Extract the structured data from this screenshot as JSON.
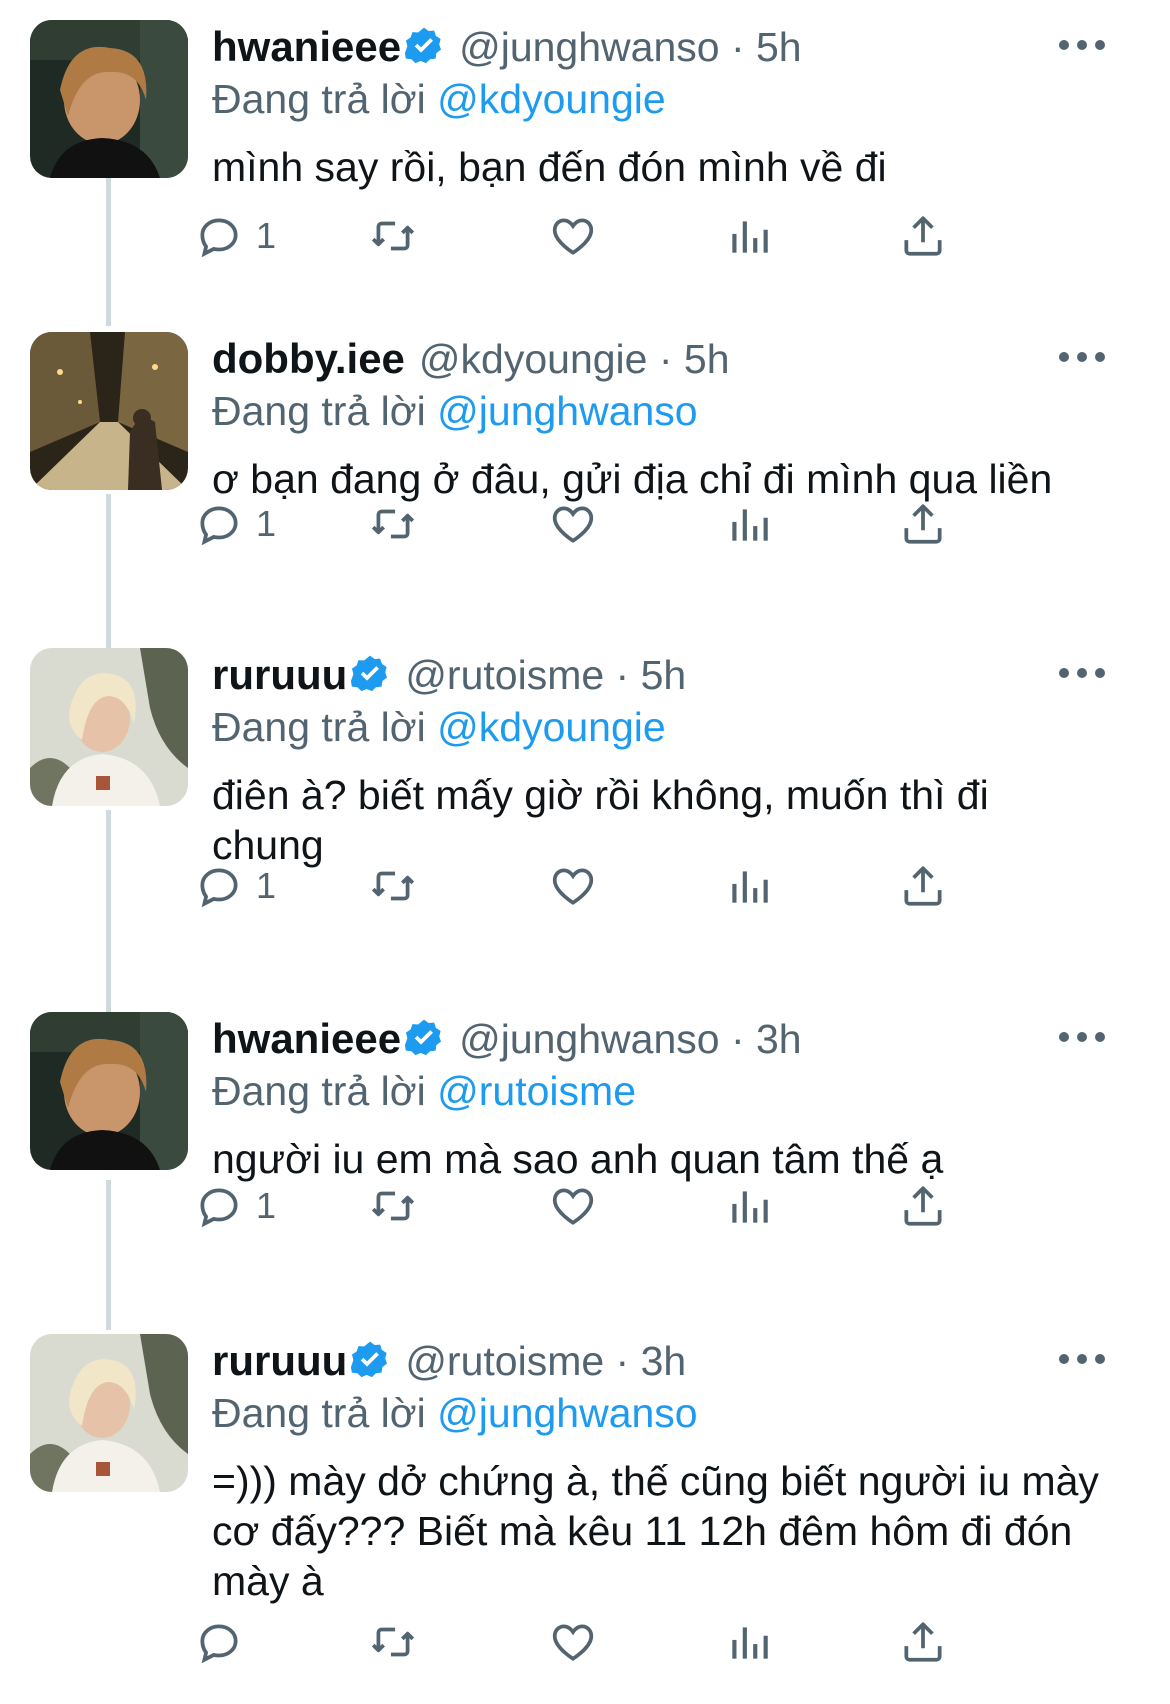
{
  "reply_prefix": "Đang trả lời",
  "icons": {
    "verified": "verified-badge-icon",
    "more": "more-options-icon",
    "reply": "reply-icon",
    "retweet": "retweet-icon",
    "like": "like-icon",
    "views": "views-icon",
    "share": "share-icon"
  },
  "colors": {
    "accent": "#1d9bf0",
    "muted": "#536471",
    "text": "#0f1419",
    "thread_line": "#cfd9de"
  },
  "tweets": [
    {
      "name": "hwanieee",
      "verified": true,
      "handle": "@junghwanso",
      "time": "5h",
      "reply_to": "@kdyoungie",
      "text": "mình say rồi, bạn đến đón mình về đi",
      "reply_count": "1"
    },
    {
      "name": "dobby.iee",
      "verified": false,
      "handle": "@kdyoungie",
      "time": "5h",
      "reply_to": "@junghwanso",
      "text": "ơ bạn đang ở đâu, gửi địa chỉ đi mình qua liền",
      "reply_count": "1"
    },
    {
      "name": "ruruuu",
      "verified": true,
      "handle": "@rutoisme",
      "time": "5h",
      "reply_to": "@kdyoungie",
      "text": "điên à? biết mấy giờ rồi không, muốn thì đi chung",
      "reply_count": "1"
    },
    {
      "name": "hwanieee",
      "verified": true,
      "handle": "@junghwanso",
      "time": "3h",
      "reply_to": "@rutoisme",
      "text": "người iu em mà sao anh quan tâm thế ạ",
      "reply_count": "1"
    },
    {
      "name": "ruruuu",
      "verified": true,
      "handle": "@rutoisme",
      "time": "3h",
      "reply_to": "@junghwanso",
      "text": "=))) mày dở chứng à, thế cũng biết người iu mày cơ đấy??? Biết mà kêu 11 12h đêm hôm đi đón mày à",
      "reply_count": ""
    }
  ]
}
